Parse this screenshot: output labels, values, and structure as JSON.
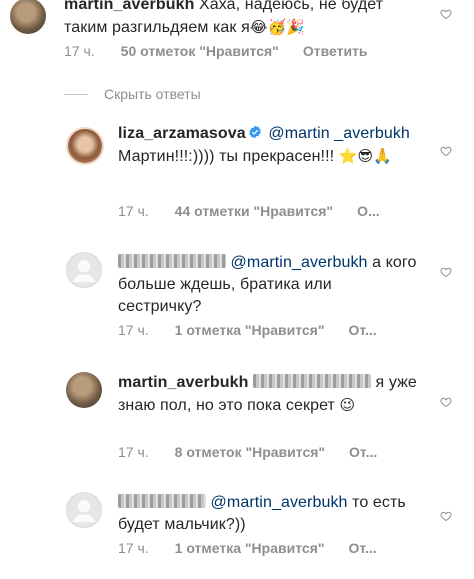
{
  "comments": [
    {
      "username": "martin_averbukh",
      "text": "Хаха, надеюсь, не будет таким разгильдяем как я",
      "emojis": "😂🥳🎉",
      "time": "17 ч.",
      "likes": "50 отметок \"Нравится\"",
      "reply": "Ответить"
    },
    {
      "username": "liza_arzamasova",
      "mention": "@martin _averbukh",
      "text": "Мартин!!!:)))) ты прекрасен!!!",
      "emojis": "⭐😎🙏",
      "time": "17 ч.",
      "likes": "44 отметки \"Нравится\"",
      "reply": "О..."
    },
    {
      "mention": "@martin_averbukh",
      "text": "а кого больше ждешь, братика или сестричку?",
      "time": "17 ч.",
      "likes": "1 отметка \"Нравится\"",
      "reply": "От..."
    },
    {
      "username": "martin_averbukh",
      "text": "я уже знаю пол, но это пока секрет",
      "emojis": "😉",
      "time": "17 ч.",
      "likes": "8 отметок \"Нравится\"",
      "reply": "От..."
    },
    {
      "mention": "@martin_averbukh",
      "text": "то есть будет мальчик?))",
      "time": "17 ч.",
      "likes": "1 отметка \"Нравится\"",
      "reply": "От..."
    }
  ],
  "hide_replies_label": "Скрыть ответы",
  "colors": {
    "mention": "#003569",
    "meta": "#8e8e8e",
    "verified": "#3897f0"
  },
  "icons": [
    "heart-outline-icon",
    "verified-badge-icon",
    "default-avatar-icon"
  ]
}
